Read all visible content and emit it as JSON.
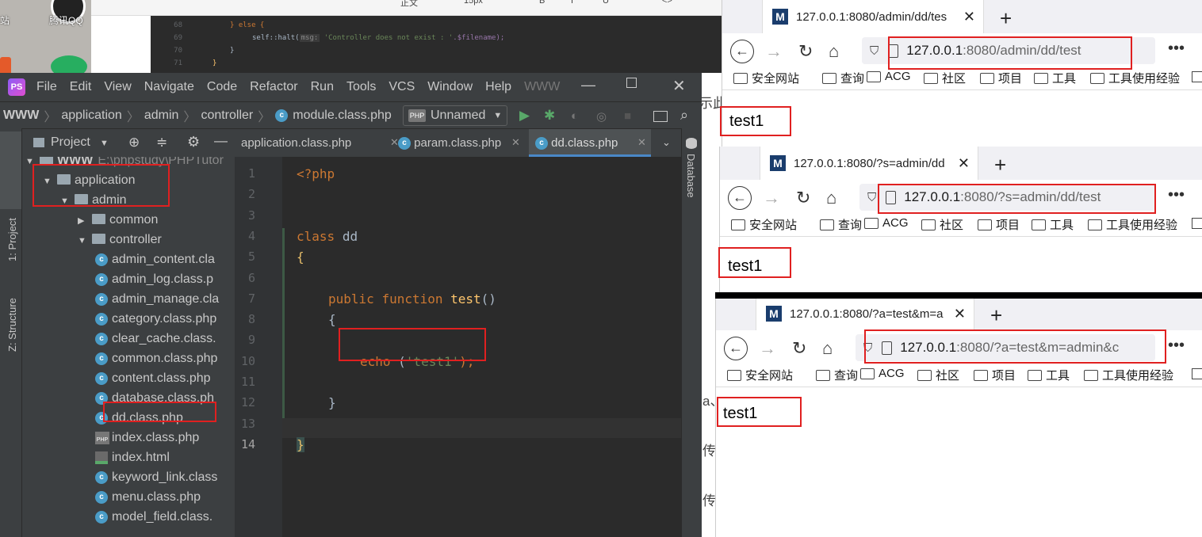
{
  "desktop": {
    "label_left": "站",
    "label_qq": "腾讯QQ"
  },
  "top_strip": {
    "items": [
      "正文",
      "15px",
      "B",
      "I",
      "U",
      "<>"
    ]
  },
  "bg_editor": {
    "lines": [
      {
        "num": "68",
        "code_else": "} else {"
      },
      {
        "num": "69",
        "code_call": "self::halt(",
        "hint": "msg:",
        "str": "'Controller does not exist : '",
        "rest": ".$filename);"
      },
      {
        "num": "70",
        "code": "}"
      },
      {
        "num": "71",
        "code": "}"
      }
    ]
  },
  "ide": {
    "logo": "PS",
    "menu": [
      "File",
      "Edit",
      "View",
      "Navigate",
      "Code",
      "Refactor",
      "Run",
      "Tools",
      "VCS",
      "Window",
      "Help",
      "WWW"
    ],
    "breadcrumb": [
      "WWW",
      "application",
      "admin",
      "controller",
      "module.class.php"
    ],
    "run_config": "Unnamed",
    "project_label": "Project",
    "left_strip": [
      "1: Project",
      "Z: Structure"
    ],
    "right_strip": "Database",
    "tabs": [
      {
        "label": "application.class.php"
      },
      {
        "label": "param.class.php"
      },
      {
        "label": "dd.class.php",
        "active": true
      }
    ],
    "tree": [
      {
        "label": "WWW",
        "path": "E:\\phpstudy\\PHPTutor",
        "kind": "folder",
        "open": true
      },
      {
        "label": "application",
        "kind": "folder",
        "open": true
      },
      {
        "label": "admin",
        "kind": "folder",
        "open": true
      },
      {
        "label": "common",
        "kind": "folder",
        "open": false
      },
      {
        "label": "controller",
        "kind": "folder",
        "open": true
      },
      {
        "label": "admin_content.cla",
        "kind": "class"
      },
      {
        "label": "admin_log.class.p",
        "kind": "class"
      },
      {
        "label": "admin_manage.cla",
        "kind": "class"
      },
      {
        "label": "category.class.php",
        "kind": "class"
      },
      {
        "label": "clear_cache.class.",
        "kind": "class"
      },
      {
        "label": "common.class.php",
        "kind": "class"
      },
      {
        "label": "content.class.php",
        "kind": "class"
      },
      {
        "label": "database.class.ph",
        "kind": "class"
      },
      {
        "label": "dd.class.php",
        "kind": "class"
      },
      {
        "label": "index.class.php",
        "kind": "php"
      },
      {
        "label": "index.html",
        "kind": "html"
      },
      {
        "label": "keyword_link.class",
        "kind": "class"
      },
      {
        "label": "menu.class.php",
        "kind": "class"
      },
      {
        "label": "model_field.class.",
        "kind": "class"
      }
    ],
    "code": {
      "line_numbers": [
        "1",
        "2",
        "3",
        "4",
        "5",
        "6",
        "7",
        "8",
        "9",
        "10",
        "11",
        "12",
        "13",
        "14"
      ],
      "open_tag": "<?php",
      "class_kw": "class",
      "class_name": "dd",
      "brace_open": "{",
      "public_kw": "public",
      "function_kw": "function",
      "fn_name": "test",
      "parens": "()",
      "inner_open": "{",
      "echo_kw": "echo",
      "echo_open": " (",
      "echo_str": "'test1'",
      "echo_close": ");",
      "inner_close": "}",
      "brace_close": "}"
    }
  },
  "browsers": [
    {
      "tab_title": "127.0.0.1:8080/admin/dd/tes",
      "url_host": "127.0.0.1",
      "url_rest": ":8080/admin/dd/test",
      "content": "test1"
    },
    {
      "tab_title": "127.0.0.1:8080/?s=admin/dd",
      "url_host": "127.0.0.1",
      "url_rest": ":8080/?s=admin/dd/test",
      "content": "test1"
    },
    {
      "tab_title": "127.0.0.1:8080/?a=test&m=a",
      "url_host": "127.0.0.1",
      "url_rest": ":8080/?a=test&m=admin&c",
      "content": "test1"
    }
  ],
  "bookmarks": [
    "安全网站",
    "查询",
    "ACG",
    "社区",
    "项目",
    "工具",
    "工具使用经验"
  ],
  "background_page": {
    "chars": [
      "示此",
      "a、",
      "传",
      "传"
    ]
  },
  "colors": {
    "highlight_box": "#e02020",
    "ide_bg": "#3c3f41",
    "editor_bg": "#2b2b2b",
    "keyword": "#cc7832",
    "string": "#6a8759",
    "function": "#ffc66d"
  }
}
